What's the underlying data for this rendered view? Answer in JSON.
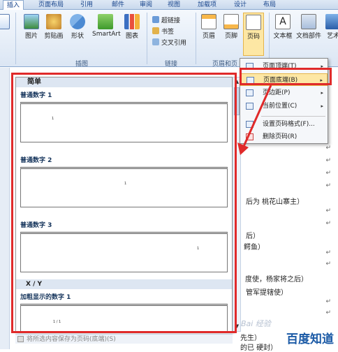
{
  "tabs": [
    "插入",
    "页面布局",
    "引用",
    "邮件",
    "审阅",
    "视图",
    "加载项",
    "设计",
    "布局"
  ],
  "ribbon": {
    "illustration_buttons": [
      "图片",
      "剪贴画",
      "形状",
      "SmartArt",
      "图表"
    ],
    "illustration_group": "插图",
    "link_buttons": [
      "超链接",
      "书签",
      "交叉引用"
    ],
    "link_group": "链接",
    "header_buttons": [
      "页眉",
      "页脚",
      "页码"
    ],
    "header_group": "页眉和页",
    "text_buttons": [
      "文本框",
      "文档部件",
      "艺术"
    ]
  },
  "gallery": {
    "header": "简单",
    "items": [
      {
        "label": "普通数字 1",
        "num": "1"
      },
      {
        "label": "普通数字 2",
        "num": "1"
      },
      {
        "label": "普通数字 3",
        "num": "1"
      }
    ],
    "category2": "X / Y",
    "item4": {
      "label": "加粗显示的数字 1",
      "num": "1 / 1"
    },
    "status": "将所选内容保存为页码(底端)(S)"
  },
  "menu": {
    "items": [
      {
        "label": "页面顶端(T)",
        "arrow": "▸"
      },
      {
        "label": "页面底端(B)",
        "arrow": "▸"
      },
      {
        "label": "页边距(P)",
        "arrow": "▸"
      },
      {
        "label": "当前位置(C)",
        "arrow": "▸"
      },
      {
        "label": "设置页码格式(F)...",
        "arrow": ""
      },
      {
        "label": "删除页码(R)",
        "arrow": ""
      }
    ]
  },
  "document": {
    "lines": [
      "后为 桃花山寨主）",
      "后）",
      "鳄鱼）",
      "度使，杨家将之后）",
      "管军提辖使）",
      "先生）",
      "的已 硬封）"
    ],
    "return_mark": "↵"
  },
  "watermark": {
    "text": "百度知道",
    "faint": "Bai 经验"
  },
  "colors": {
    "highlight": "#fde7a4",
    "red": "#e02a2a",
    "ribbon_bg": "#dbe6f4"
  }
}
